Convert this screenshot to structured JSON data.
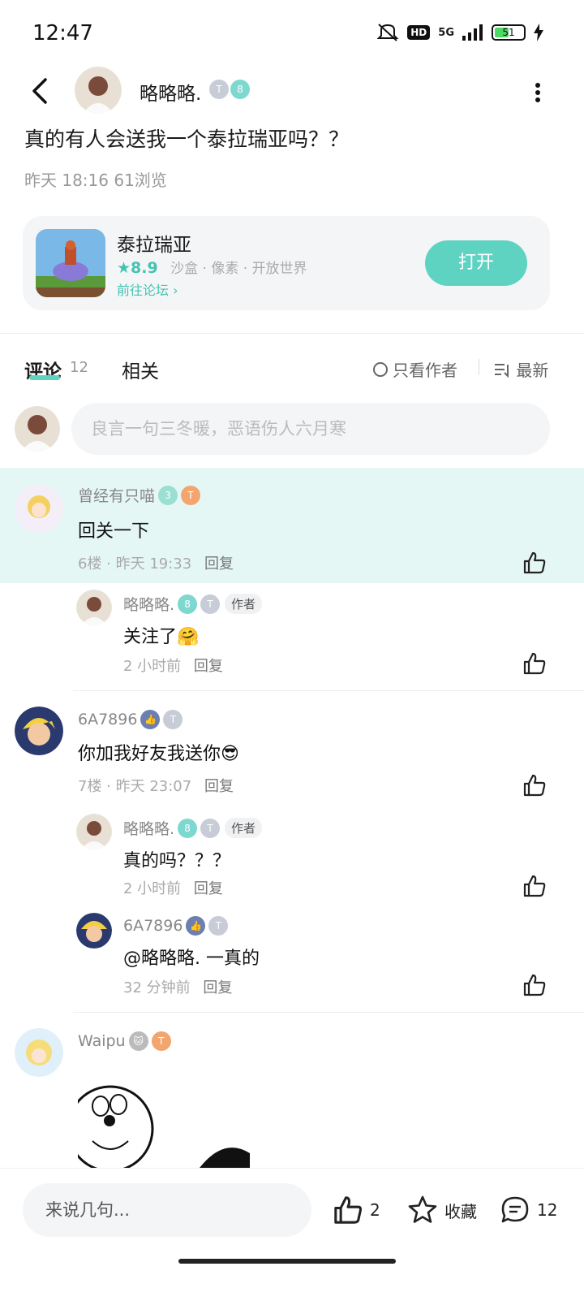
{
  "status": {
    "time": "12:47",
    "network": "5G",
    "hd": "HD",
    "battery": "51",
    "battery_level": 0.51
  },
  "header": {
    "author_name": "略略略.",
    "badge_level": "8",
    "badge_t": "T"
  },
  "post": {
    "title": "真的有人会送我一个泰拉瑞亚吗？？",
    "meta": "昨天 18:16  61浏览"
  },
  "game_card": {
    "name": "泰拉瑞亚",
    "score": "★8.9",
    "tags": "沙盒 · 像素 · 开放世界",
    "forum_link": "前往论坛 ›",
    "open_label": "打开"
  },
  "tabs": {
    "comments": "评论",
    "comments_count": "12",
    "related": "相关",
    "only_author": "只看作者",
    "latest": "最新"
  },
  "comment_input": {
    "placeholder": "良言一句三冬暖，恶语伤人六月寒"
  },
  "comments": [
    {
      "name": "曾经有只喵",
      "text": "回关一下",
      "meta": "6楼 · 昨天 19:33",
      "reply": "回复"
    },
    {
      "name": "略略略.",
      "author_tag": "作者",
      "text": "关注了🤗",
      "meta": "2 小时前",
      "reply": "回复"
    },
    {
      "name": "6A7896",
      "text": "你加我好友我送你😎",
      "meta": "7楼 · 昨天 23:07",
      "reply": "回复"
    },
    {
      "name": "略略略.",
      "author_tag": "作者",
      "text": "真的吗？？？",
      "meta": "2 小时前",
      "reply": "回复"
    },
    {
      "name": "6A7896",
      "text": "@略略略.  一真的",
      "meta": "32 分钟前",
      "reply": "回复"
    },
    {
      "name": "Waipu"
    }
  ],
  "bottom_bar": {
    "input_placeholder": "来说几句...",
    "like_count": "2",
    "favorite_label": "收藏",
    "comment_count": "12"
  },
  "colors": {
    "accent": "#5fd3c2",
    "highlight": "#e5f7f4"
  }
}
